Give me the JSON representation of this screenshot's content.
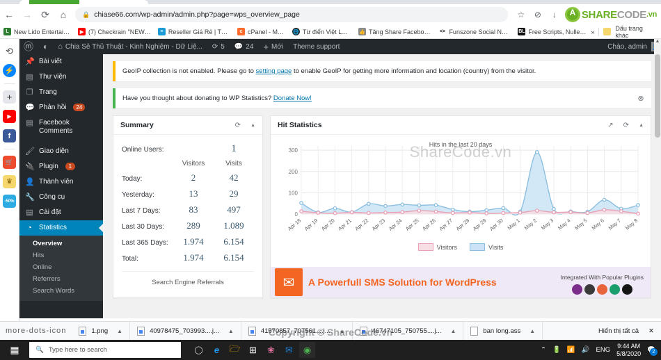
{
  "browser": {
    "nav": {
      "back": "←",
      "forward": "→",
      "reload": "⟳",
      "home": "⌂"
    },
    "address": {
      "lock_icon": "lock-icon",
      "url": "chiase66.com/wp-admin/admin.php?page=wps_overview_page"
    },
    "toolbar_icons": [
      {
        "name": "bookmark-star-icon",
        "glyph": "☆"
      },
      {
        "name": "shield-block-icon",
        "glyph": "⊘"
      },
      {
        "name": "download-icon",
        "glyph": "↓"
      }
    ],
    "logo": {
      "share": "SHARE",
      "code": "CODE",
      "vn": ".vn"
    },
    "bookmarks": [
      {
        "label": "New Lido Entertain...",
        "fav": "lido-icon",
        "color": "#2e7d32"
      },
      {
        "label": "(7) Checkrain \"NEW\"...",
        "fav": "youtube-icon",
        "color": "#ff0000"
      },
      {
        "label": "Reseller Giá Rẻ | Tối...",
        "fav": "reseller-icon",
        "color": "#1d9bd7"
      },
      {
        "label": "cPanel - Main",
        "fav": "cpanel-icon",
        "color": "#ff6c2c"
      },
      {
        "label": "Từ điển Việt Lào .",
        "fav": "globe-icon",
        "color": "#2b2b2b"
      },
      {
        "label": "Tăng Share Faceboo...",
        "fav": "thumbs-up-icon",
        "color": "#8a8a8a"
      },
      {
        "label": "Funszone Social Net...",
        "fav": "code-brackets-icon",
        "color": "#1b1b1b"
      },
      {
        "label": "Free Scripts, Nulled...",
        "fav": "bl-icon",
        "color": "#111111"
      }
    ],
    "bookmarks_overflow": "»",
    "other_bookmarks": "Dấu trang khác"
  },
  "leftrail": [
    {
      "name": "history-icon",
      "glyph": "↺",
      "bg": "#ffffff",
      "color": "#444"
    },
    {
      "name": "messenger-icon",
      "glyph": "⚡",
      "bg": "#0084ff",
      "color": "#fff"
    },
    {
      "name": "add-icon",
      "glyph": "+",
      "bg": "#e4e6eb",
      "color": "#333"
    },
    {
      "name": "youtube-icon",
      "glyph": "▶",
      "bg": "#ff0000",
      "color": "#fff"
    },
    {
      "name": "facebook-icon",
      "glyph": "f",
      "bg": "#3b5998",
      "color": "#fff"
    },
    {
      "name": "shopee-icon",
      "glyph": "Ṡ",
      "bg": "#ee4d2d",
      "color": "#fff"
    },
    {
      "name": "game-icon",
      "glyph": "♛",
      "bg": "#f5d76e",
      "color": "#7a5c00"
    },
    {
      "name": "tiki-sale-icon",
      "glyph": "-50%",
      "bg": "#2dabe2",
      "color": "#fff"
    },
    {
      "name": "bell-icon",
      "glyph": "🔔",
      "bg": "#ffffff",
      "color": "#444"
    }
  ],
  "wpadminbar": {
    "wp_logo": "wordpress-logo-icon",
    "stats_icon": "chart-pie-icon",
    "home_icon": "home-icon",
    "site_title": "Chia Sẻ Thủ Thuật - Kinh Nghiệm - Dữ Liệ...",
    "updates_icon": "updates-icon",
    "updates_count": "5",
    "comments_icon": "comment-icon",
    "comments_count": "24",
    "new_icon": "plus-icon",
    "new_label": "Mới",
    "theme_support": "Theme support",
    "greeting": "Chào, admin",
    "avatar": "avatar"
  },
  "wpmenu": {
    "items": [
      {
        "label": "Bài viết",
        "icon": "pin-icon",
        "glyph": "📌",
        "badge": null,
        "active": false
      },
      {
        "label": "Thư viện",
        "icon": "media-icon",
        "glyph": "▤",
        "badge": null,
        "active": false
      },
      {
        "label": "Trang",
        "icon": "page-icon",
        "glyph": "❐",
        "badge": null,
        "active": false
      },
      {
        "label": "Phản hồi",
        "icon": "comment-icon",
        "glyph": "⬛",
        "badge": "24",
        "active": false
      },
      {
        "label": "Facebook Comments",
        "icon": "facebook-icon",
        "glyph": "f",
        "badge": null,
        "active": false
      },
      {
        "label": "__SEP__",
        "icon": "",
        "glyph": "",
        "badge": null,
        "active": false
      },
      {
        "label": "Giao diện",
        "icon": "appearance-icon",
        "glyph": "🖌",
        "badge": null,
        "active": false
      },
      {
        "label": "Plugin",
        "icon": "plugin-icon",
        "glyph": "🔌",
        "badge": "1",
        "active": false
      },
      {
        "label": "Thành viên",
        "icon": "users-icon",
        "glyph": "👤",
        "badge": null,
        "active": false
      },
      {
        "label": "Công cụ",
        "icon": "tools-icon",
        "glyph": "🔧",
        "badge": null,
        "active": false
      },
      {
        "label": "Cài đặt",
        "icon": "settings-icon",
        "glyph": "⚙",
        "badge": null,
        "active": false
      },
      {
        "label": "Statistics",
        "icon": "statistics-icon",
        "glyph": "◔",
        "badge": null,
        "active": true
      }
    ],
    "submenu": [
      {
        "label": "Overview",
        "current": true
      },
      {
        "label": "Hits",
        "current": false
      },
      {
        "label": "Online",
        "current": false
      },
      {
        "label": "Referrers",
        "current": false
      },
      {
        "label": "Search Words",
        "current": false
      }
    ]
  },
  "notices": [
    {
      "type": "warning",
      "text_before": "GeoIP collection is not enabled. Please go to ",
      "link": "setting page",
      "text_after": " to enable GeoIP for getting more information and location (country) from the visitor.",
      "dismiss": null
    },
    {
      "type": "success",
      "text_before": "Have you thought about donating to WP Statistics? ",
      "link": "Donate Now!",
      "text_after": "",
      "dismiss": "⊗"
    }
  ],
  "summary": {
    "title": "Summary",
    "refresh_icon": "refresh-icon",
    "collapse_icon": "chevron-up-icon",
    "online_label": "Online Users:",
    "online_value": "1",
    "col_visitors": "Visitors",
    "col_visits": "Visits",
    "rows": [
      {
        "label": "Today:",
        "visitors": "2",
        "visits": "42"
      },
      {
        "label": "Yesterday:",
        "visitors": "13",
        "visits": "29"
      },
      {
        "label": "Last 7 Days:",
        "visitors": "83",
        "visits": "497"
      },
      {
        "label": "Last 30 Days:",
        "visitors": "289",
        "visits": "1.089"
      },
      {
        "label": "Last 365 Days:",
        "visitors": "1.974",
        "visits": "6.154"
      },
      {
        "label": "Total:",
        "visitors": "1.974",
        "visits": "6.154"
      }
    ],
    "search_engine_referrals": "Search Engine Referrals"
  },
  "hitstats": {
    "title": "Hit Statistics",
    "popout_icon": "external-link-icon",
    "refresh_icon": "refresh-icon",
    "collapse_icon": "chevron-up-icon",
    "watermark": "ShareCode.vn"
  },
  "chart_data": {
    "type": "area",
    "title": "Hits in the last 20 days",
    "xlabel": "",
    "ylabel": "",
    "ylim": [
      0,
      320
    ],
    "yticks": [
      0,
      100,
      200,
      300
    ],
    "grid": true,
    "legend_position": "bottom",
    "categories": [
      "Apr 18",
      "Apr 19",
      "Apr 20",
      "Apr 21",
      "Apr 22",
      "Apr 23",
      "Apr 24",
      "Apr 25",
      "Apr 26",
      "Apr 27",
      "Apr 28",
      "Apr 29",
      "Apr 30",
      "May 1",
      "May 2",
      "May 3",
      "May 4",
      "May 5",
      "May 6",
      "May 7",
      "May 8"
    ],
    "series": [
      {
        "name": "Visitors",
        "color": "#e8a0b4",
        "fill": "#f7dde4",
        "values": [
          13,
          6,
          4,
          8,
          5,
          7,
          9,
          16,
          12,
          5,
          7,
          3,
          5,
          7,
          16,
          8,
          9,
          5,
          20,
          13,
          2
        ]
      },
      {
        "name": "Visits",
        "color": "#8bbfe0",
        "fill": "#cbe4f5",
        "values": [
          52,
          8,
          27,
          9,
          48,
          38,
          45,
          41,
          42,
          21,
          11,
          18,
          28,
          11,
          291,
          24,
          12,
          11,
          67,
          25,
          42
        ]
      }
    ]
  },
  "sms_banner": {
    "icon": "envelope-icon",
    "headline": "A Powerfull SMS Solution for WordPress",
    "subhead": "Integrated With Popular Plugins"
  },
  "downloads": {
    "overflow_icon": "more-dots-icon",
    "items": [
      {
        "label": "1.png",
        "type": "image"
      },
      {
        "label": "40978475_703993....j...",
        "type": "image"
      },
      {
        "label": "41570857_707561....j...",
        "type": "image"
      },
      {
        "label": "46747105_750755....j...",
        "type": "image"
      },
      {
        "label": "ban long.ass",
        "type": "file"
      }
    ],
    "show_all": "Hiển thị tất cả",
    "close_icon": "close-icon"
  },
  "copyright": "Copyright © ShareCode.vn",
  "taskbar": {
    "start_icon": "windows-start-icon",
    "search_icon": "search-icon",
    "search_placeholder": "Type here to search",
    "cortana_icon": "cortana-icon",
    "apps": [
      {
        "name": "edge-icon",
        "glyph": "e",
        "color": "#0e7ac4",
        "bg": "transparent"
      },
      {
        "name": "file-explorer-icon",
        "glyph": "🗀",
        "color": "#ffb900",
        "bg": "transparent"
      },
      {
        "name": "store-icon",
        "glyph": "⊞",
        "color": "#ffffff",
        "bg": "transparent"
      },
      {
        "name": "photos-icon",
        "glyph": "❀",
        "color": "#d86f9a",
        "bg": "transparent"
      },
      {
        "name": "mail-icon",
        "glyph": "✉",
        "color": "#1a7fd4",
        "bg": "transparent"
      },
      {
        "name": "chrome-icon",
        "glyph": "◉",
        "color": "#4caf50",
        "bg": "transparent"
      }
    ],
    "tray": {
      "chevron": "⌃",
      "battery_icon": "battery-icon",
      "wifi_icon": "wifi-icon",
      "volume_icon": "volume-icon",
      "language": "ENG",
      "time": "9:44 AM",
      "date": "5/8/2020",
      "notifications_icon": "notifications-icon",
      "notifications_count": "2"
    }
  }
}
